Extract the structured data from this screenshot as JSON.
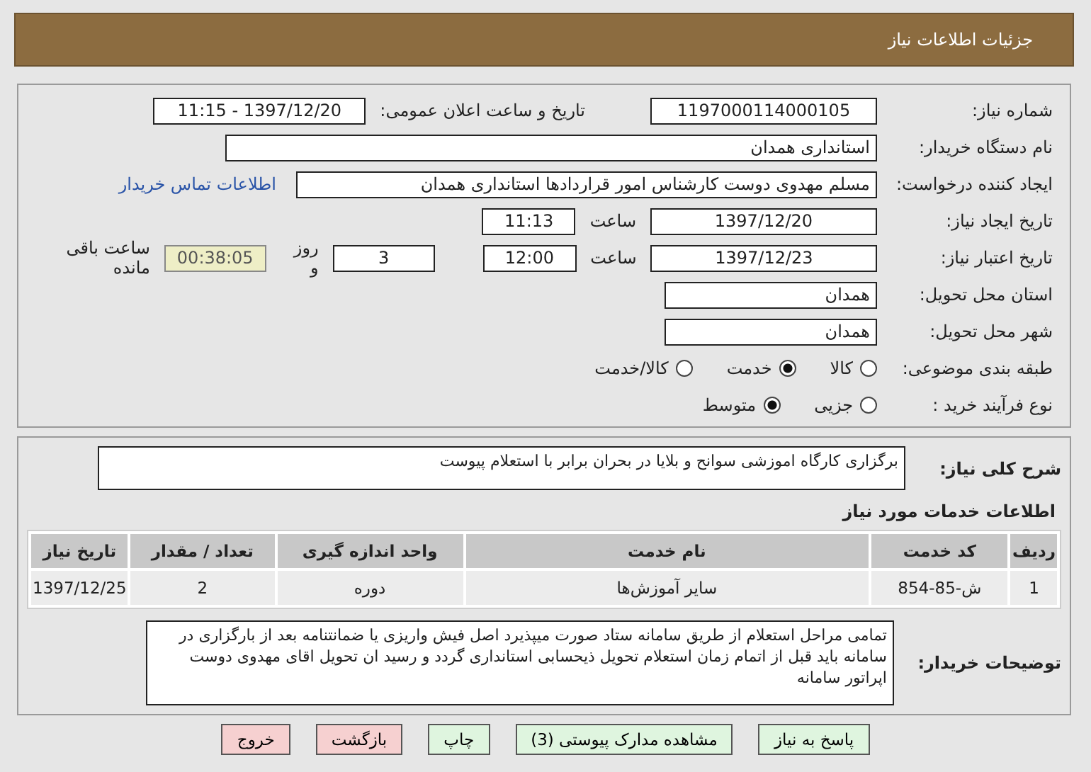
{
  "header": {
    "title": "جزئیات اطلاعات نیاز"
  },
  "need_number": {
    "label": "شماره نیاز:",
    "value": "1197000114000105"
  },
  "announce": {
    "label": "تاریخ و ساعت اعلان عمومی:",
    "value": "1397/12/20 - 11:15"
  },
  "buyer_org": {
    "label": "نام دستگاه خریدار:",
    "value": "استانداری همدان"
  },
  "requester": {
    "label": "ایجاد کننده درخواست:",
    "value": "مسلم مهدوی دوست کارشناس امور قراردادها استانداری همدان",
    "link": "اطلاعات تماس خریدار"
  },
  "created": {
    "label": "تاریخ ایجاد نیاز:",
    "date": "1397/12/20",
    "time_label": "ساعت",
    "time": "11:13"
  },
  "validity": {
    "label": "تاریخ اعتبار نیاز:",
    "date": "1397/12/23",
    "time_label": "ساعت",
    "time": "12:00",
    "days": "3",
    "days_label": "روز و",
    "remaining": "00:38:05",
    "remaining_label": "ساعت باقی مانده"
  },
  "province": {
    "label": "استان محل تحویل:",
    "value": "همدان"
  },
  "city": {
    "label": "شهر محل تحویل:",
    "value": "همدان"
  },
  "category": {
    "label": "طبقه بندی موضوعی:",
    "options": [
      {
        "label": "کالا",
        "selected": false
      },
      {
        "label": "خدمت",
        "selected": true
      },
      {
        "label": "کالا/خدمت",
        "selected": false
      }
    ]
  },
  "process": {
    "label": "نوع فرآیند خرید :",
    "options": [
      {
        "label": "جزیی",
        "selected": false
      },
      {
        "label": "متوسط",
        "selected": true
      }
    ]
  },
  "description": {
    "label": "شرح کلی نیاز:",
    "value": "برگزاری کارگاه اموزشی سوانح و بلایا در بحران  برابر با استعلام پیوست"
  },
  "services": {
    "title": "اطلاعات خدمات مورد نیاز",
    "columns": [
      "ردیف",
      "کد خدمت",
      "نام خدمت",
      "واحد اندازه گیری",
      "تعداد / مقدار",
      "تاریخ نیاز"
    ],
    "rows": [
      [
        "1",
        "ش-85-854",
        "سایر آموزش‌ها",
        "دوره",
        "2",
        "1397/12/25"
      ]
    ]
  },
  "buyer_notes": {
    "label": "توضیحات خریدار:",
    "value": "تمامی مراحل استعلام از طریق سامانه ستاد صورت میپذیرد اصل فیش واریزی یا ضمانتنامه بعد از بارگزاری در سامانه باید قبل از اتمام زمان استعلام تحویل ذیحسابی استانداری گردد و رسید ان تحویل اقای مهدوی دوست اپراتور سامانه"
  },
  "buttons": [
    {
      "label": "پاسخ به نیاز",
      "kind": "action"
    },
    {
      "label": "مشاهده مدارک پیوستی (3)",
      "kind": "action"
    },
    {
      "label": "چاپ",
      "kind": "action"
    },
    {
      "label": "بازگشت",
      "kind": "exit"
    },
    {
      "label": "خروج",
      "kind": "exit"
    }
  ]
}
